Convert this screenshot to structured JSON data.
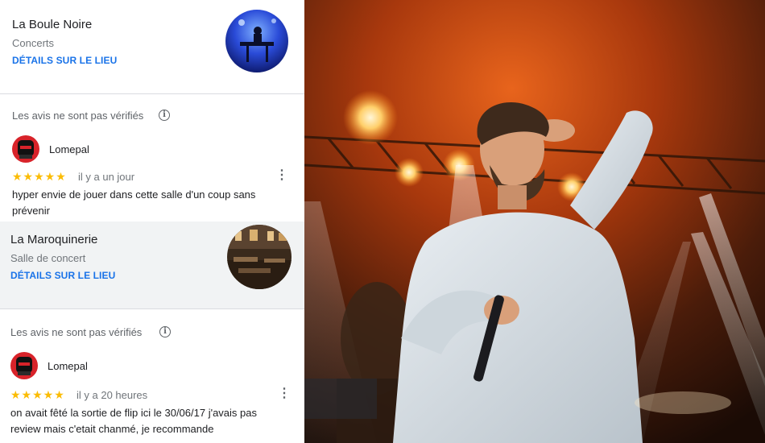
{
  "places": [
    {
      "name": "La Boule Noire",
      "category": "Concerts",
      "details_link": "DÉTAILS SUR LE LIEU",
      "notice": "Les avis ne sont pas vérifiés",
      "review": {
        "author": "Lomepal",
        "rating": 5,
        "stars": "★★★★★",
        "time": "il y a un jour",
        "text_lines": [
          "hyper envie de jouer dans cette salle d'un coup sans",
          "prévenir"
        ]
      }
    },
    {
      "name": "La Maroquinerie",
      "category": "Salle de concert",
      "details_link": "DÉTAILS SUR LE LIEU",
      "notice": "Les avis ne sont pas vérifiés",
      "review": {
        "author": "Lomepal",
        "rating": 5,
        "stars": "★★★★★",
        "time": "il y a 20 heures",
        "text_lines": [
          "on avait fêté la sortie de flip ici le 30/06/17 j'avais pas",
          "review mais c'etait chanmé, je recommande"
        ]
      }
    }
  ],
  "icons": {
    "info": "info-icon",
    "more": "more-vert-icon",
    "star": "star-icon"
  },
  "colors": {
    "link": "#1a73e8",
    "star": "#fbbc04",
    "secondary_text": "#70757a",
    "avatar": "#d8232a"
  }
}
